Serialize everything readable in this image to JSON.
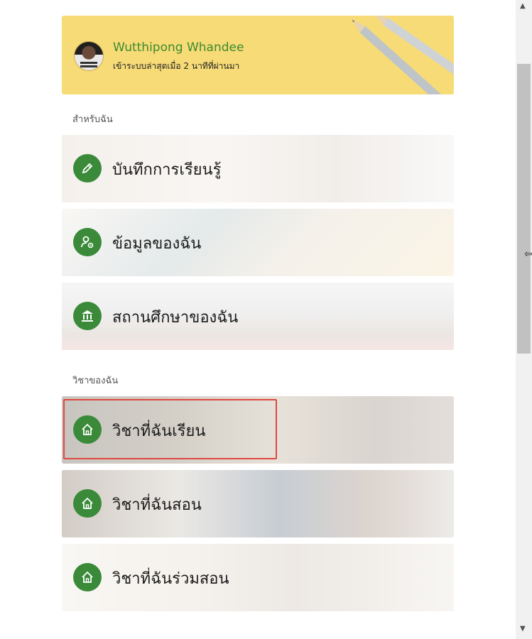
{
  "profile": {
    "name": "Wutthipong Whandee",
    "last_login": "เข้าระบบล่าสุดเมื่อ 2 นาทีที่ผ่านมา"
  },
  "sections": {
    "for_me": "สำหรับฉัน",
    "my_subjects": "วิชาของฉัน"
  },
  "tiles": [
    {
      "label": "บันทึกการเรียนรู้",
      "icon": "pencil-icon"
    },
    {
      "label": "ข้อมูลของฉัน",
      "icon": "user-gear-icon"
    },
    {
      "label": "สถานศึกษาของฉัน",
      "icon": "institution-icon"
    },
    {
      "label": "วิชาที่ฉันเรียน",
      "icon": "home-icon"
    },
    {
      "label": "วิชาที่ฉันสอน",
      "icon": "home-icon"
    },
    {
      "label": "วิชาที่ฉันร่วมสอน",
      "icon": "home-icon"
    }
  ],
  "colors": {
    "accent_green": "#3a8a3a",
    "profile_bg": "#f7db77",
    "highlight": "#e0483f"
  }
}
